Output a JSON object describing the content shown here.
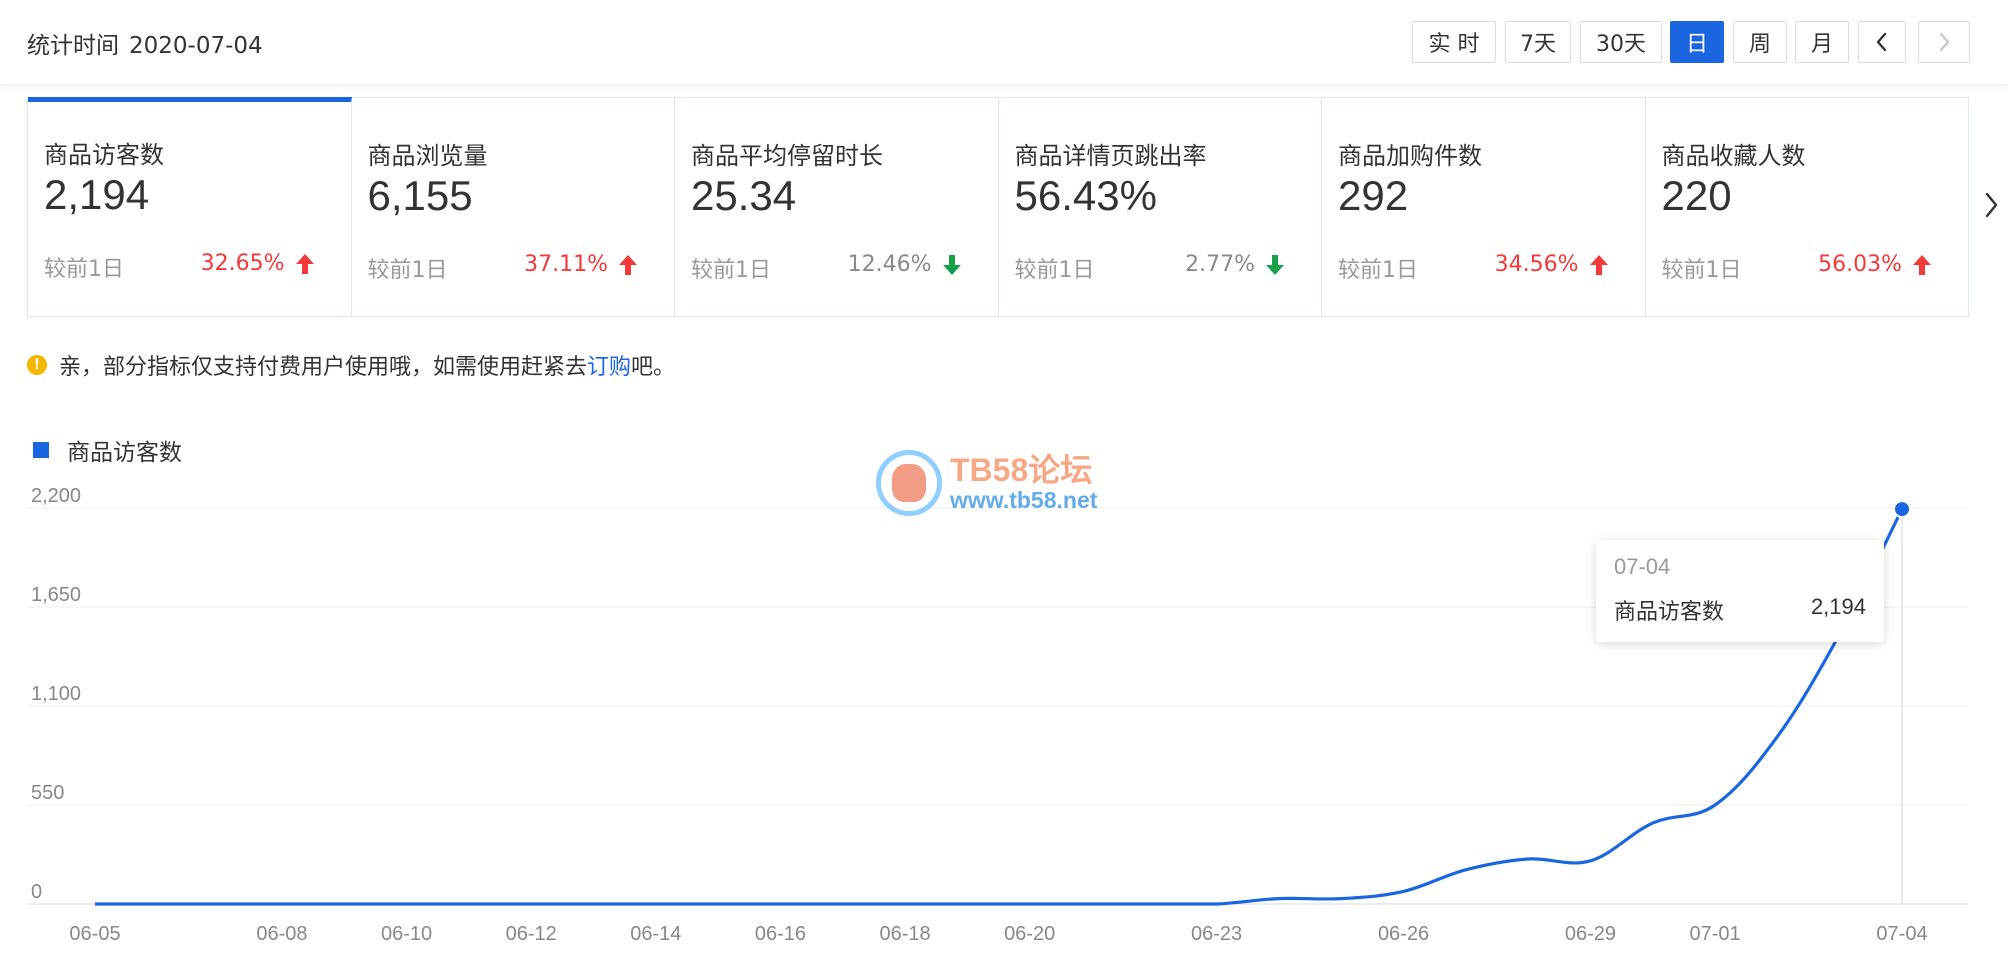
{
  "header": {
    "stat_label": "统计时间",
    "stat_date": "2020-07-04",
    "buttons": {
      "realtime": "实 时",
      "d7": "7天",
      "d30": "30天",
      "day": "日",
      "week": "周",
      "month": "月"
    },
    "active_button": "日"
  },
  "metrics": [
    {
      "label": "商品访客数",
      "value": "2,194",
      "compare": "较前1日",
      "delta": "32.65%",
      "trend": "up"
    },
    {
      "label": "商品浏览量",
      "value": "6,155",
      "compare": "较前1日",
      "delta": "37.11%",
      "trend": "up"
    },
    {
      "label": "商品平均停留时长",
      "value": "25.34",
      "compare": "较前1日",
      "delta": "12.46%",
      "trend": "down"
    },
    {
      "label": "商品详情页跳出率",
      "value": "56.43%",
      "compare": "较前1日",
      "delta": "2.77%",
      "trend": "down"
    },
    {
      "label": "商品加购件数",
      "value": "292",
      "compare": "较前1日",
      "delta": "34.56%",
      "trend": "up"
    },
    {
      "label": "商品收藏人数",
      "value": "220",
      "compare": "较前1日",
      "delta": "56.03%",
      "trend": "up"
    }
  ],
  "notice": {
    "text_before": "亲，部分指标仅支持付费用户使用哦，如需使用赶紧去",
    "link": "订购",
    "text_after": "吧。"
  },
  "watermark": {
    "title": "TB58论坛",
    "url": "www.tb58.net"
  },
  "tooltip": {
    "date": "07-04",
    "label": "商品访客数",
    "value": "2,194"
  },
  "colors": {
    "accent": "#1a66e0",
    "up": "#f23a3a",
    "down_arrow": "#1aa04a"
  },
  "chart_data": {
    "type": "line",
    "legend": "商品访客数",
    "ylim": [
      0,
      2200
    ],
    "yticks": [
      "0",
      "550",
      "1,100",
      "1,650",
      "2,200"
    ],
    "x": [
      "06-05",
      "06-06",
      "06-07",
      "06-08",
      "06-09",
      "06-10",
      "06-11",
      "06-12",
      "06-13",
      "06-14",
      "06-15",
      "06-16",
      "06-17",
      "06-18",
      "06-19",
      "06-20",
      "06-21",
      "06-22",
      "06-23",
      "06-24",
      "06-25",
      "06-26",
      "06-27",
      "06-28",
      "06-29",
      "06-30",
      "07-01",
      "07-02",
      "07-03",
      "07-04"
    ],
    "xtick_labels": [
      "06-05",
      "06-08",
      "06-10",
      "06-12",
      "06-14",
      "06-16",
      "06-18",
      "06-20",
      "06-23",
      "06-26",
      "06-29",
      "07-01",
      "07-04"
    ],
    "series": [
      {
        "name": "商品访客数",
        "values": [
          0,
          0,
          0,
          0,
          0,
          0,
          0,
          0,
          0,
          0,
          0,
          0,
          0,
          0,
          0,
          0,
          0,
          0,
          0,
          30,
          30,
          70,
          190,
          250,
          240,
          450,
          550,
          930,
          1500,
          2194
        ]
      }
    ],
    "grid": true
  }
}
